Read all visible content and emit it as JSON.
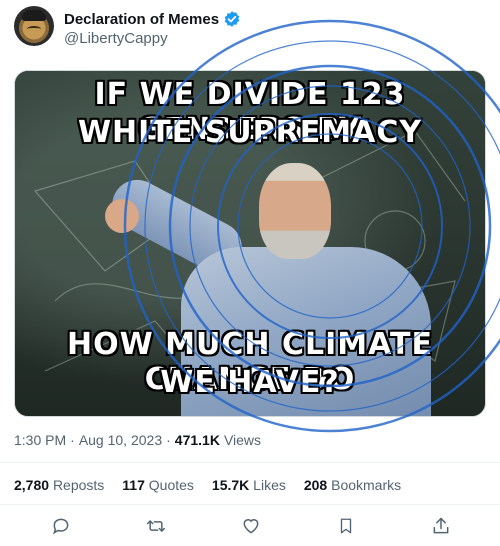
{
  "author": {
    "display_name": "Declaration of Memes",
    "handle": "@LibertyCappy",
    "verified": true
  },
  "media": {
    "top_text": [
      "IF WE DIVIDE 123 GENDERS BY",
      "WHITE SUPREMACY"
    ],
    "bottom_text": [
      "HOW MUCH CLIMATE CHANGE DO",
      "WE HAVE?"
    ]
  },
  "meta": {
    "time": "1:30 PM",
    "separator": "·",
    "date": "Aug 10, 2023",
    "views_count": "471.1K",
    "views_label": "Views"
  },
  "stats": {
    "reposts_count": "2,780",
    "reposts_label": "Reposts",
    "quotes_count": "117",
    "quotes_label": "Quotes",
    "likes_count": "15.7K",
    "likes_label": "Likes",
    "bookmarks_count": "208",
    "bookmarks_label": "Bookmarks"
  },
  "actions": [
    "reply-icon",
    "repost-icon",
    "like-icon",
    "bookmark-icon",
    "share-icon"
  ],
  "colors": {
    "verified": "#1d9bf0",
    "stamp": "#1f63c9",
    "muted_text": "#536471",
    "primary_text": "#0f1419"
  }
}
